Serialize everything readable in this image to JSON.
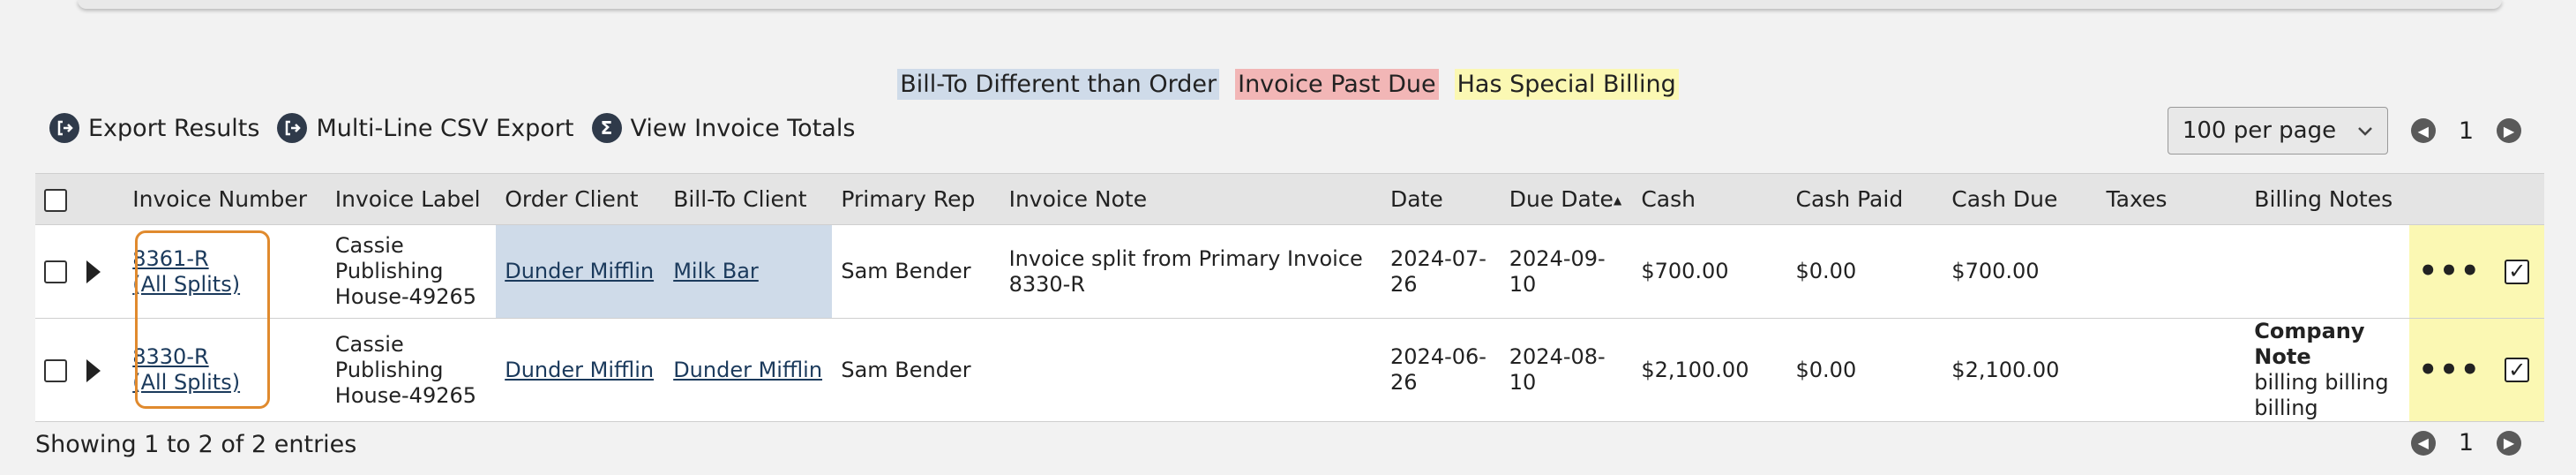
{
  "legend": {
    "bill_to_diff": "Bill-To Different than Order",
    "past_due": "Invoice Past Due",
    "special_billing": "Has Special Billing"
  },
  "toolbar": {
    "export_results": "Export Results",
    "multi_line_csv": "Multi-Line CSV Export",
    "view_totals": "View Invoice Totals"
  },
  "pager": {
    "per_page": "100 per page",
    "page": "1"
  },
  "columns": {
    "invoice_number": "Invoice Number",
    "invoice_label": "Invoice Label",
    "order_client": "Order Client",
    "bill_to_client": "Bill-To Client",
    "primary_rep": "Primary Rep",
    "invoice_note": "Invoice Note",
    "date": "Date",
    "due_date": "Due Date",
    "cash": "Cash",
    "cash_paid": "Cash Paid",
    "cash_due": "Cash Due",
    "taxes": "Taxes",
    "billing_notes": "Billing Notes"
  },
  "rows": [
    {
      "invoice_number": "8361-R",
      "all_splits": "(All Splits)",
      "label_line1": "Cassie",
      "label_line2": "Publishing",
      "label_line3": "House-49265",
      "order_client": "Dunder Mifflin",
      "bill_to_client": "Milk Bar",
      "primary_rep": "Sam Bender",
      "invoice_note": "Invoice split from Primary Invoice 8330-R",
      "date": "2024-07-26",
      "due_date": "2024-09-10",
      "cash": "$700.00",
      "cash_paid": "$0.00",
      "cash_due": "$700.00",
      "taxes": "",
      "billing_note_title": "",
      "billing_note_body1": "",
      "billing_note_body2": ""
    },
    {
      "invoice_number": "8330-R",
      "all_splits": "(All Splits)",
      "label_line1": "Cassie",
      "label_line2": "Publishing",
      "label_line3": "House-49265",
      "order_client": "Dunder Mifflin",
      "bill_to_client": "Dunder Mifflin",
      "primary_rep": "Sam Bender",
      "invoice_note": "",
      "date": "2024-06-26",
      "due_date": "2024-08-10",
      "cash": "$2,100.00",
      "cash_paid": "$0.00",
      "cash_due": "$2,100.00",
      "taxes": "",
      "billing_note_title": "Company Note",
      "billing_note_body1": "billing billing",
      "billing_note_body2": "billing"
    }
  ],
  "footer": {
    "showing": "Showing 1 to 2 of 2 entries"
  },
  "icons": {
    "more": "•••",
    "check": "✓",
    "sigma": "Σ",
    "sort_up": "▲",
    "chev_down": "⌄",
    "prev": "◀",
    "next": "▶"
  },
  "colors": {
    "bill_to_diff": "#cfdbe9",
    "past_due": "#f2b6b6",
    "special_billing": "#fbf8b3",
    "highlight": "#e08a2e"
  }
}
